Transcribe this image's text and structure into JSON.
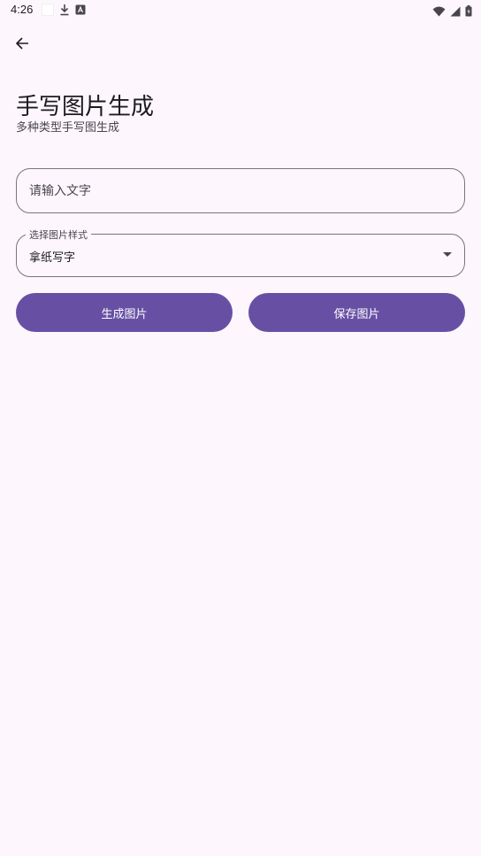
{
  "status_bar": {
    "time": "4:26",
    "icons": [
      "notification-square-icon",
      "download-icon",
      "a-icon",
      "wifi-icon",
      "signal-icon",
      "battery-icon"
    ]
  },
  "header": {
    "back_icon": "arrow-back-icon",
    "title": "手写图片生成",
    "subtitle": "多种类型手写图生成"
  },
  "form": {
    "text_input": {
      "placeholder": "请输入文字",
      "value": ""
    },
    "style_select": {
      "label": "选择图片样式",
      "selected": "拿纸写字"
    }
  },
  "actions": {
    "generate_label": "生成图片",
    "save_label": "保存图片"
  },
  "colors": {
    "background": "#fdf7fd",
    "primary": "#6750a4",
    "outline": "#79747e"
  }
}
